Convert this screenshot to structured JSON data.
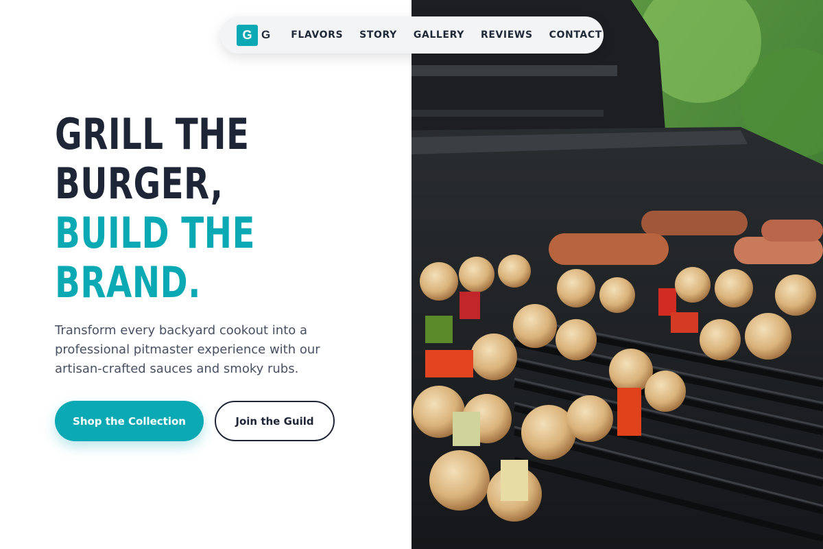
{
  "nav": {
    "logo_mark": "G",
    "logo_text": "G",
    "links": [
      "FLAVORS",
      "STORY",
      "GALLERY",
      "REVIEWS",
      "CONTACT"
    ]
  },
  "hero": {
    "headline_line1": "GRILL THE",
    "headline_line2": "BURGER,",
    "headline_line3": "BUILD THE",
    "headline_line4": "BRAND.",
    "description": "Transform every backyard cookout into a professional pitmaster experience with our artisan-crafted sauces and smoky rubs.",
    "primary_cta": "Shop the Collection",
    "secondary_cta": "Join the Guild"
  },
  "colors": {
    "accent": "#0aa9b3",
    "heading_dark": "#1e2536",
    "body_text": "#475063"
  }
}
